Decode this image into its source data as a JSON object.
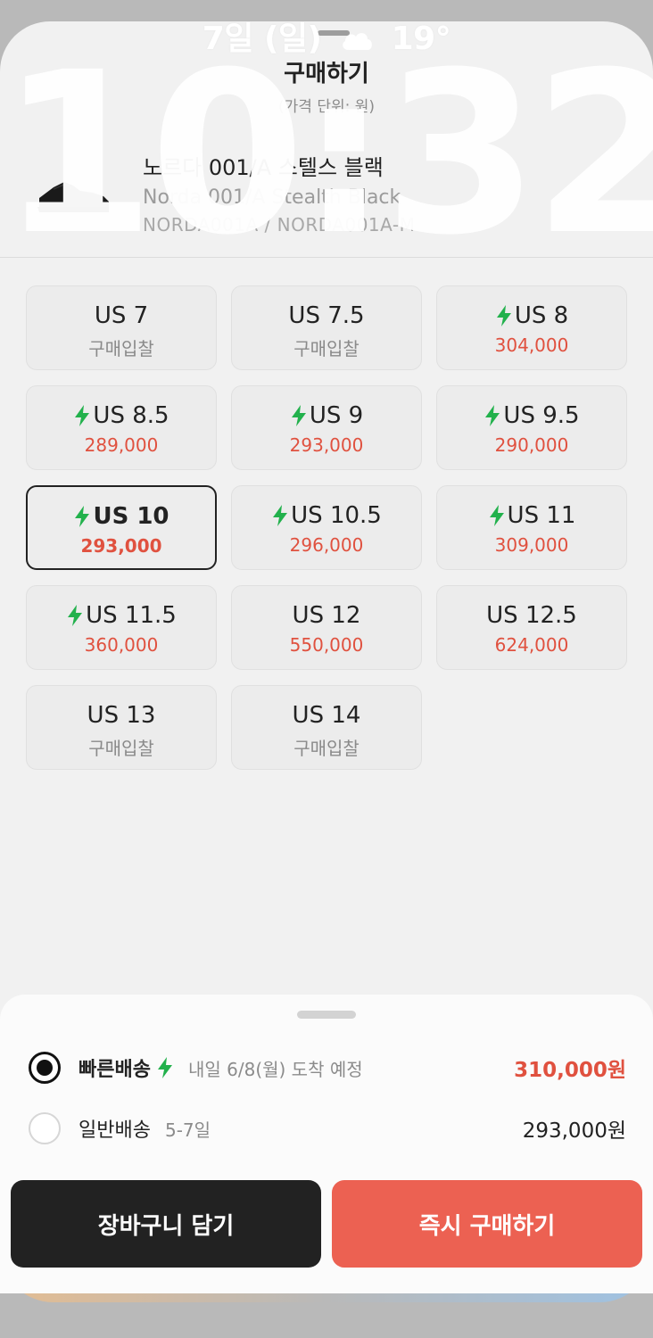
{
  "status": {
    "date": "7일 (일)",
    "weather_icon": "cloud-icon",
    "temp": "19°",
    "clock": "10:32"
  },
  "sheet": {
    "title": "구매하기",
    "subtitle": "(가격 단위: 원)"
  },
  "product": {
    "name_ko": "노르다 001/A 스텔스 블랙",
    "name_en": "Norda 001/A Stealth Black",
    "code": "NORDA001A / NORDA001A-M"
  },
  "sizes": [
    {
      "label": "US 7",
      "sub": "구매입찰",
      "fast": false,
      "type": "bid"
    },
    {
      "label": "US 7.5",
      "sub": "구매입찰",
      "fast": false,
      "type": "bid"
    },
    {
      "label": "US 8",
      "sub": "304,000",
      "fast": true,
      "type": "price"
    },
    {
      "label": "US 8.5",
      "sub": "289,000",
      "fast": true,
      "type": "price"
    },
    {
      "label": "US 9",
      "sub": "293,000",
      "fast": true,
      "type": "price"
    },
    {
      "label": "US 9.5",
      "sub": "290,000",
      "fast": true,
      "type": "price"
    },
    {
      "label": "US 10",
      "sub": "293,000",
      "fast": true,
      "type": "price",
      "selected": true
    },
    {
      "label": "US 10.5",
      "sub": "296,000",
      "fast": true,
      "type": "price"
    },
    {
      "label": "US 11",
      "sub": "309,000",
      "fast": true,
      "type": "price"
    },
    {
      "label": "US 11.5",
      "sub": "360,000",
      "fast": true,
      "type": "price"
    },
    {
      "label": "US 12",
      "sub": "550,000",
      "fast": false,
      "type": "price"
    },
    {
      "label": "US 12.5",
      "sub": "624,000",
      "fast": false,
      "type": "price"
    },
    {
      "label": "US 13",
      "sub": "구매입찰",
      "fast": false,
      "type": "bid"
    },
    {
      "label": "US 14",
      "sub": "구매입찰",
      "fast": false,
      "type": "bid"
    }
  ],
  "shipping": {
    "fast": {
      "name": "빠른배송",
      "note": "내일 6/8(월) 도착 예정",
      "price": "310,000원",
      "checked": true
    },
    "normal": {
      "name": "일반배송",
      "note": "5-7일",
      "price": "293,000원",
      "checked": false
    }
  },
  "buttons": {
    "cart": "장바구니 담기",
    "buy": "즉시 구매하기"
  },
  "colors": {
    "accent": "#e0513f",
    "bolt": "#22b14c",
    "buy_button": "#ec6152",
    "dark": "#222222"
  }
}
